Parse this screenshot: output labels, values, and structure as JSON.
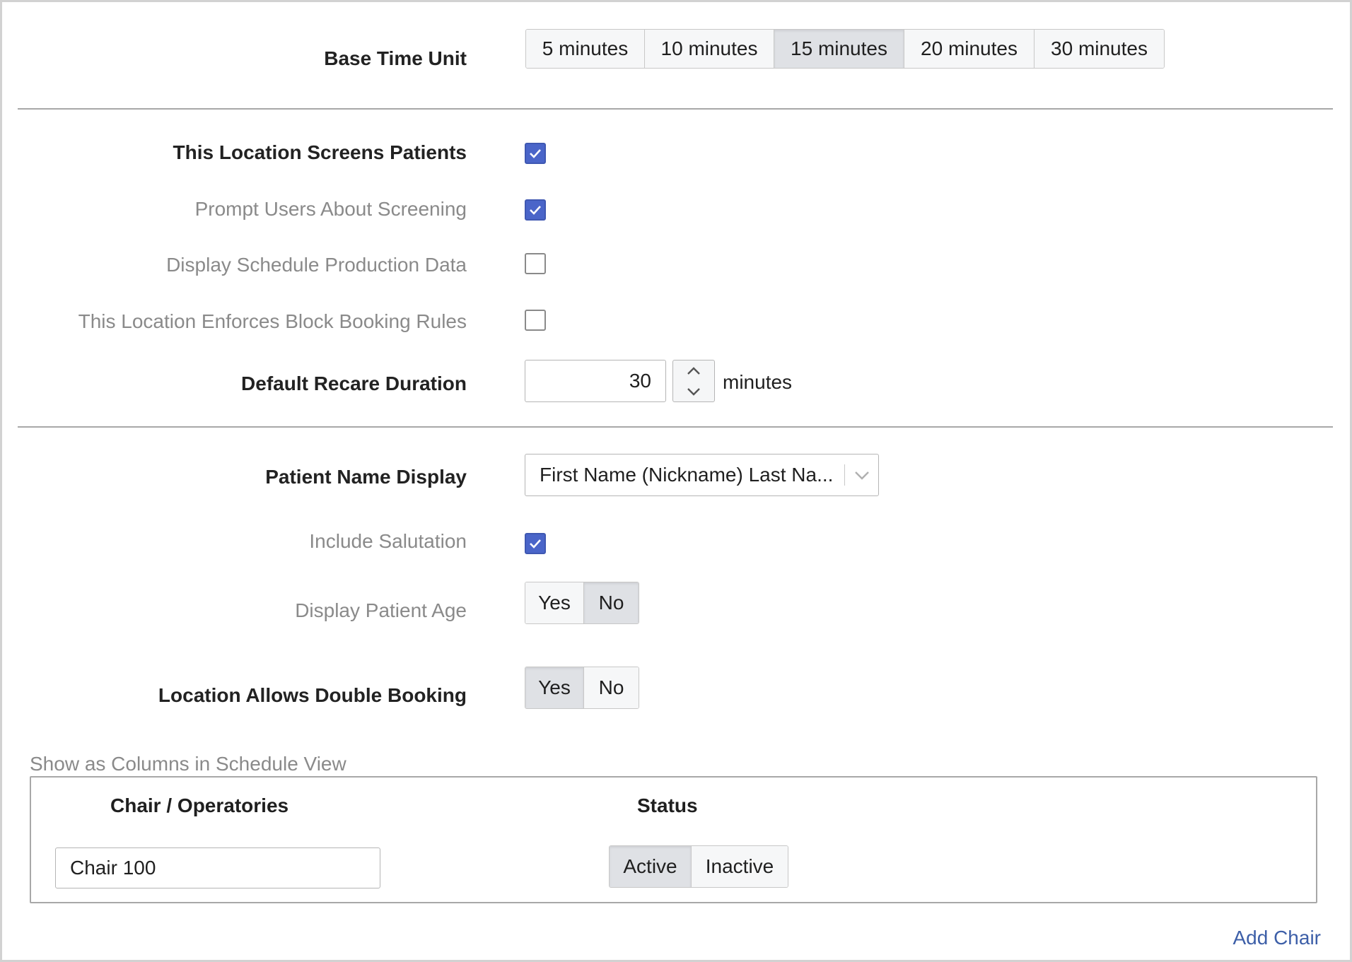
{
  "base_time_unit": {
    "label": "Base Time Unit",
    "options": [
      "5 minutes",
      "10 minutes",
      "15 minutes",
      "20 minutes",
      "30 minutes"
    ],
    "selected": "15 minutes"
  },
  "screening": {
    "screens_patients": {
      "label": "This Location Screens Patients",
      "checked": true
    },
    "prompt_users": {
      "label": "Prompt Users About Screening",
      "checked": true
    },
    "display_production": {
      "label": "Display Schedule Production Data",
      "checked": false
    },
    "enforce_block_booking": {
      "label": "This Location Enforces Block Booking Rules",
      "checked": false
    }
  },
  "recare": {
    "label": "Default Recare Duration",
    "value": "30",
    "unit": "minutes"
  },
  "patient_name_display": {
    "label": "Patient Name Display",
    "selected": "First Name (Nickname) Last Na..."
  },
  "include_salutation": {
    "label": "Include Salutation",
    "checked": true
  },
  "display_patient_age": {
    "label": "Display Patient Age",
    "options": [
      "Yes",
      "No"
    ],
    "selected": "No"
  },
  "double_booking": {
    "label": "Location Allows Double Booking",
    "options": [
      "Yes",
      "No"
    ],
    "selected": "Yes"
  },
  "columns": {
    "legend": "Show as Columns in Schedule View",
    "header_chair": "Chair / Operatories",
    "header_status": "Status",
    "rows": [
      {
        "chair": "Chair 100",
        "status_options": [
          "Active",
          "Inactive"
        ],
        "status": "Active"
      }
    ]
  },
  "add_chair_label": "Add Chair",
  "colors": {
    "checkbox": "#4a65c9",
    "link": "#3d5fa8",
    "selected_segment": "#dfe1e5"
  }
}
